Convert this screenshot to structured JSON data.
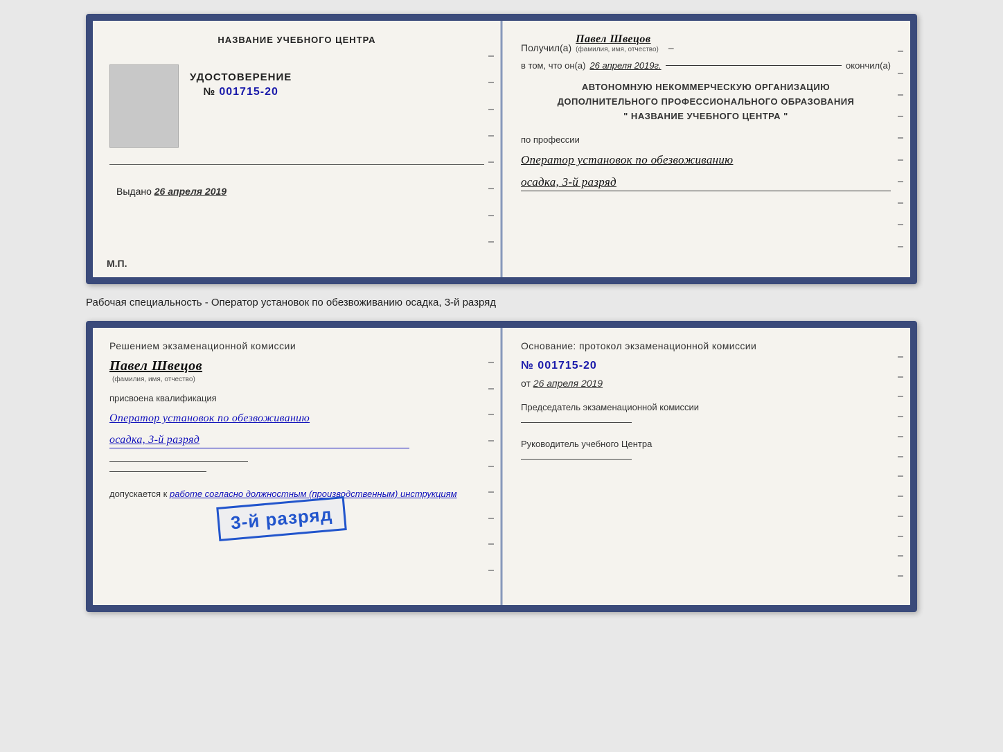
{
  "page": {
    "background_color": "#e8e8e8"
  },
  "top_book": {
    "left_page": {
      "org_name": "НАЗВАНИЕ УЧЕБНОГО ЦЕНТРА",
      "cert_title": "УДОСТОВЕРЕНИЕ",
      "cert_number_label": "№",
      "cert_number": "001715-20",
      "issued_label": "Выдано",
      "issued_date": "26 апреля 2019",
      "mp_label": "М.П."
    },
    "right_page": {
      "received_label": "Получил(а)",
      "recipient_name": "Павел Швецов",
      "name_hint": "(фамилия, имя, отчество)",
      "dash_label": "–",
      "in_that_label": "в том, что он(а)",
      "completed_date": "26 апреля 2019г.",
      "completed_label": "окончил(а)",
      "org_line1": "АВТОНОМНУЮ НЕКОММЕРЧЕСКУЮ ОРГАНИЗАЦИЮ",
      "org_line2": "ДОПОЛНИТЕЛЬНОГО ПРОФЕССИОНАЛЬНОГО ОБРАЗОВАНИЯ",
      "org_line3": "\" НАЗВАНИЕ УЧЕБНОГО ЦЕНТРА \"",
      "profession_label": "по профессии",
      "profession_value": "Оператор установок по обезвоживанию",
      "rank_value": "осадка, 3-й разряд"
    }
  },
  "separator": {
    "text": "Рабочая специальность - Оператор установок по обезвоживанию осадка, 3-й разряд"
  },
  "bottom_book": {
    "left_page": {
      "decision_text": "Решением экзаменационной комиссии",
      "name": "Павел Швецов",
      "name_hint": "(фамилия, имя, отчество)",
      "qualification_assigned": "присвоена квалификация",
      "qualification_value": "Оператор установок по обезвоживанию",
      "rank_value": "осадка, 3-й разряд",
      "admits_label": "допускается к",
      "admits_value": "работе согласно должностным (производственным) инструкциям"
    },
    "stamp": {
      "text": "3-й разряд"
    },
    "right_page": {
      "basis_label": "Основание: протокол экзаменационной комиссии",
      "protocol_number_label": "№",
      "protocol_number": "001715-20",
      "from_label": "от",
      "from_date": "26 апреля 2019",
      "chairman_label": "Председатель экзаменационной комиссии",
      "director_label": "Руководитель учебного Центра"
    }
  }
}
